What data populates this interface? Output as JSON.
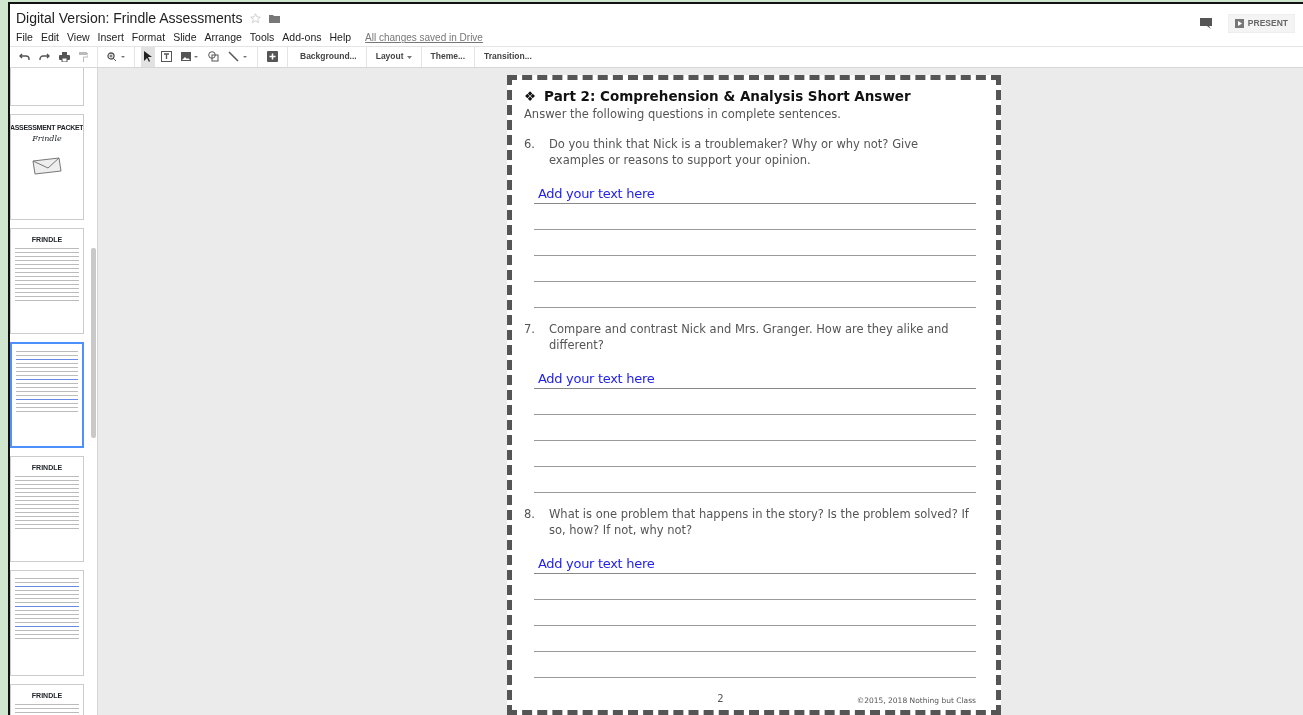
{
  "window": {
    "title": "Digital Version: Frindle Assessments",
    "starred": false
  },
  "menu": [
    "File",
    "Edit",
    "View",
    "Insert",
    "Format",
    "Slide",
    "Arrange",
    "Tools",
    "Add-ons",
    "Help"
  ],
  "save_status": "All changes saved in Drive",
  "toolbar": {
    "text_buttons": [
      {
        "label": "Background...",
        "dropdown": false
      },
      {
        "label": "Layout",
        "dropdown": true
      },
      {
        "label": "Theme...",
        "dropdown": false
      },
      {
        "label": "Transition...",
        "dropdown": false
      }
    ]
  },
  "present_button": "PRESENT",
  "slides": [
    {
      "kind": "blank",
      "selected": false
    },
    {
      "kind": "cover",
      "title": "ASSESSMENT PACKET",
      "subtitle": "Frindle",
      "selected": false
    },
    {
      "kind": "quiz",
      "heading": "FRINDLE",
      "selected": false
    },
    {
      "kind": "answers",
      "selected": true
    },
    {
      "kind": "quiz",
      "heading": "FRINDLE",
      "selected": false
    },
    {
      "kind": "answers",
      "selected": false
    },
    {
      "kind": "quiz",
      "heading": "FRINDLE",
      "selected": false
    }
  ],
  "slide": {
    "bullet": "❖",
    "heading": "Part 2: Comprehension & Analysis Short Answer",
    "instructions": "Answer the following questions in complete sentences.",
    "questions": [
      {
        "number": "6.",
        "text": "Do you think that Nick is a troublemaker? Why or why not? Give examples or reasons to support your opinion.",
        "answer": "Add your text here"
      },
      {
        "number": "7.",
        "text": "Compare and contrast Nick and Mrs. Granger. How are they alike and different?",
        "answer": "Add your text here"
      },
      {
        "number": "8.",
        "text": "What is one problem that happens in the story? Is the problem solved? If so, how? If not, why not?",
        "answer": "Add your text here"
      }
    ],
    "page_number": "2",
    "copyright": "©2015, 2018 Nothing but Class"
  }
}
